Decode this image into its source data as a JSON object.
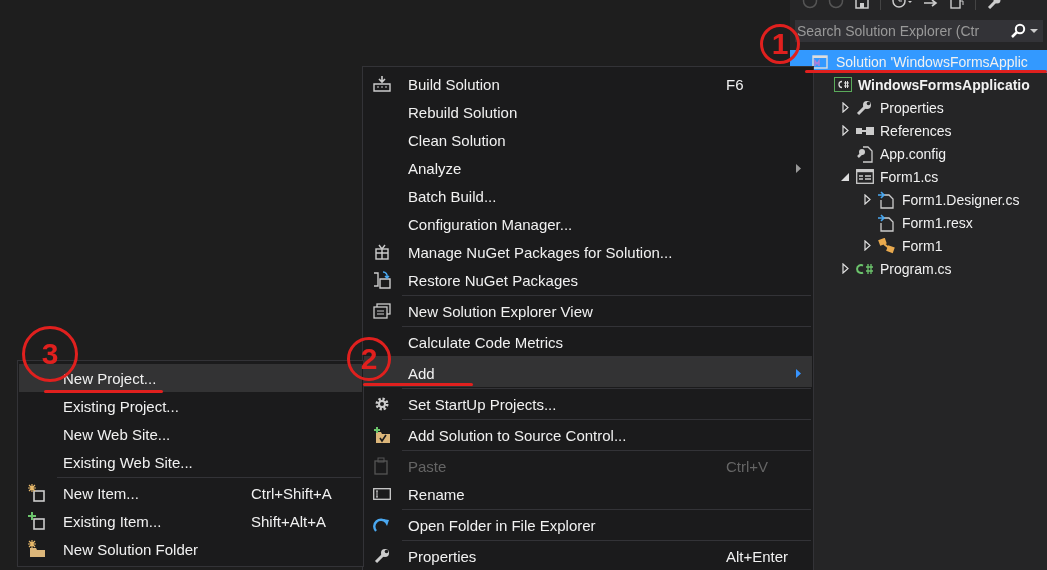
{
  "solution_explorer": {
    "search": {
      "placeholder": "Search Solution Explorer (Ctr"
    },
    "tree": [
      {
        "label": "Solution 'WindowsFormsApplic",
        "kind": "solution",
        "selected": true,
        "children": [
          {
            "label": "WindowsFormsApplicatio",
            "kind": "project",
            "selected": false,
            "children": [
              {
                "label": "Properties",
                "kind": "properties",
                "selected": false,
                "expanded": false
              },
              {
                "label": "References",
                "kind": "references",
                "selected": false,
                "expanded": false
              },
              {
                "label": "App.config",
                "kind": "config",
                "selected": false
              },
              {
                "label": "Form1.cs",
                "kind": "form",
                "selected": false,
                "expanded": true,
                "children": [
                  {
                    "label": "Form1.Designer.cs",
                    "kind": "code",
                    "selected": false,
                    "expanded": false
                  },
                  {
                    "label": "Form1.resx",
                    "kind": "resource",
                    "selected": false
                  },
                  {
                    "label": "Form1",
                    "kind": "class",
                    "selected": false,
                    "expanded": false
                  }
                ]
              },
              {
                "label": "Program.cs",
                "kind": "csharp",
                "selected": false,
                "expanded": false
              }
            ]
          }
        ]
      }
    ]
  },
  "context_menu": {
    "items": [
      {
        "label": "Build Solution",
        "shortcut": "F6",
        "submenu": false,
        "separator_before": false,
        "disabled": false,
        "selected": false
      },
      {
        "label": "Rebuild Solution",
        "submenu": false,
        "separator_before": false,
        "disabled": false,
        "selected": false
      },
      {
        "label": "Clean Solution",
        "submenu": false,
        "separator_before": false,
        "disabled": false,
        "selected": false
      },
      {
        "label": "Analyze",
        "submenu": true,
        "separator_before": false,
        "disabled": false,
        "selected": false
      },
      {
        "label": "Batch Build...",
        "submenu": false,
        "separator_before": false,
        "disabled": false,
        "selected": false
      },
      {
        "label": "Configuration Manager...",
        "submenu": false,
        "separator_before": false,
        "disabled": false,
        "selected": false
      },
      {
        "label": "Manage NuGet Packages for Solution...",
        "submenu": false,
        "separator_before": false,
        "disabled": false,
        "selected": false
      },
      {
        "label": "Restore NuGet Packages",
        "submenu": false,
        "separator_before": false,
        "disabled": false,
        "selected": false
      },
      {
        "label": "New Solution Explorer View",
        "submenu": false,
        "separator_before": true,
        "disabled": false,
        "selected": false
      },
      {
        "label": "Calculate Code Metrics",
        "submenu": false,
        "separator_before": true,
        "disabled": false,
        "selected": false
      },
      {
        "label": "Add",
        "submenu": true,
        "separator_before": true,
        "disabled": false,
        "selected": true
      },
      {
        "label": "Set StartUp Projects...",
        "submenu": false,
        "separator_before": true,
        "disabled": false,
        "selected": false
      },
      {
        "label": "Add Solution to Source Control...",
        "submenu": false,
        "separator_before": true,
        "disabled": false,
        "selected": false
      },
      {
        "label": "Paste",
        "shortcut": "Ctrl+V",
        "submenu": false,
        "separator_before": true,
        "disabled": true,
        "selected": false
      },
      {
        "label": "Rename",
        "submenu": false,
        "separator_before": false,
        "disabled": false,
        "selected": false
      },
      {
        "label": "Open Folder in File Explorer",
        "submenu": false,
        "separator_before": true,
        "disabled": false,
        "selected": false
      },
      {
        "label": "Properties",
        "shortcut": "Alt+Enter",
        "submenu": false,
        "separator_before": true,
        "disabled": false,
        "selected": false
      }
    ]
  },
  "add_submenu": {
    "items": [
      {
        "label": "New Project...",
        "submenu": false,
        "separator_before": false,
        "disabled": false,
        "selected": true
      },
      {
        "label": "Existing Project...",
        "submenu": false,
        "separator_before": false,
        "disabled": false,
        "selected": false
      },
      {
        "label": "New Web Site...",
        "submenu": false,
        "separator_before": false,
        "disabled": false,
        "selected": false
      },
      {
        "label": "Existing Web Site...",
        "submenu": false,
        "separator_before": false,
        "disabled": false,
        "selected": false
      },
      {
        "label": "New Item...",
        "shortcut": "Ctrl+Shift+A",
        "submenu": false,
        "separator_before": true,
        "disabled": false,
        "selected": false
      },
      {
        "label": "Existing Item...",
        "shortcut": "Shift+Alt+A",
        "submenu": false,
        "separator_before": false,
        "disabled": false,
        "selected": false
      },
      {
        "label": "New Solution Folder",
        "submenu": false,
        "separator_before": false,
        "disabled": false,
        "selected": false
      }
    ]
  },
  "annotations": [
    {
      "label": "1"
    },
    {
      "label": "2"
    },
    {
      "label": "3"
    }
  ]
}
